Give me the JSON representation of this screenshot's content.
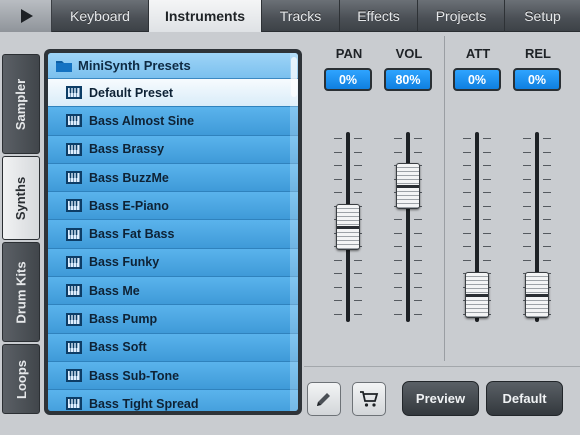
{
  "topbar": {
    "play_icon": "play-icon",
    "tabs": [
      "Keyboard",
      "Instruments",
      "Tracks",
      "Effects",
      "Projects",
      "Setup"
    ],
    "active_tab": "Instruments"
  },
  "side_tabs": {
    "items": [
      "Sampler",
      "Synths",
      "Drum Kits",
      "Loops"
    ],
    "active": "Synths"
  },
  "preset_list": {
    "folder_icon": "folder-icon",
    "header": "MiniSynth Presets",
    "item_icon": "piano-keyboard-icon",
    "items": [
      "Default Preset",
      "Bass Almost Sine",
      "Bass Brassy",
      "Bass BuzzMe",
      "Bass E-Piano",
      "Bass Fat Bass",
      "Bass Funky",
      "Bass Me",
      "Bass Pump",
      "Bass Soft",
      "Bass Sub-Tone",
      "Bass Tight Spread"
    ],
    "selected": "Default Preset"
  },
  "mixer": {
    "channels": [
      {
        "label": "PAN",
        "value": "0%",
        "level": 0.5
      },
      {
        "label": "VOL",
        "value": "80%",
        "level": 0.8
      },
      {
        "label": "ATT",
        "value": "0%",
        "level": 0.0
      },
      {
        "label": "REL",
        "value": "0%",
        "level": 0.0
      }
    ]
  },
  "toolbar": {
    "edit_icon": "pencil-icon",
    "cart_icon": "shopping-cart-icon",
    "preview_label": "Preview",
    "default_label": "Default"
  },
  "colors": {
    "accent_blue": "#1a8cf0",
    "list_blue": "#4fa7e4",
    "selected_row": "#eef6fc"
  }
}
